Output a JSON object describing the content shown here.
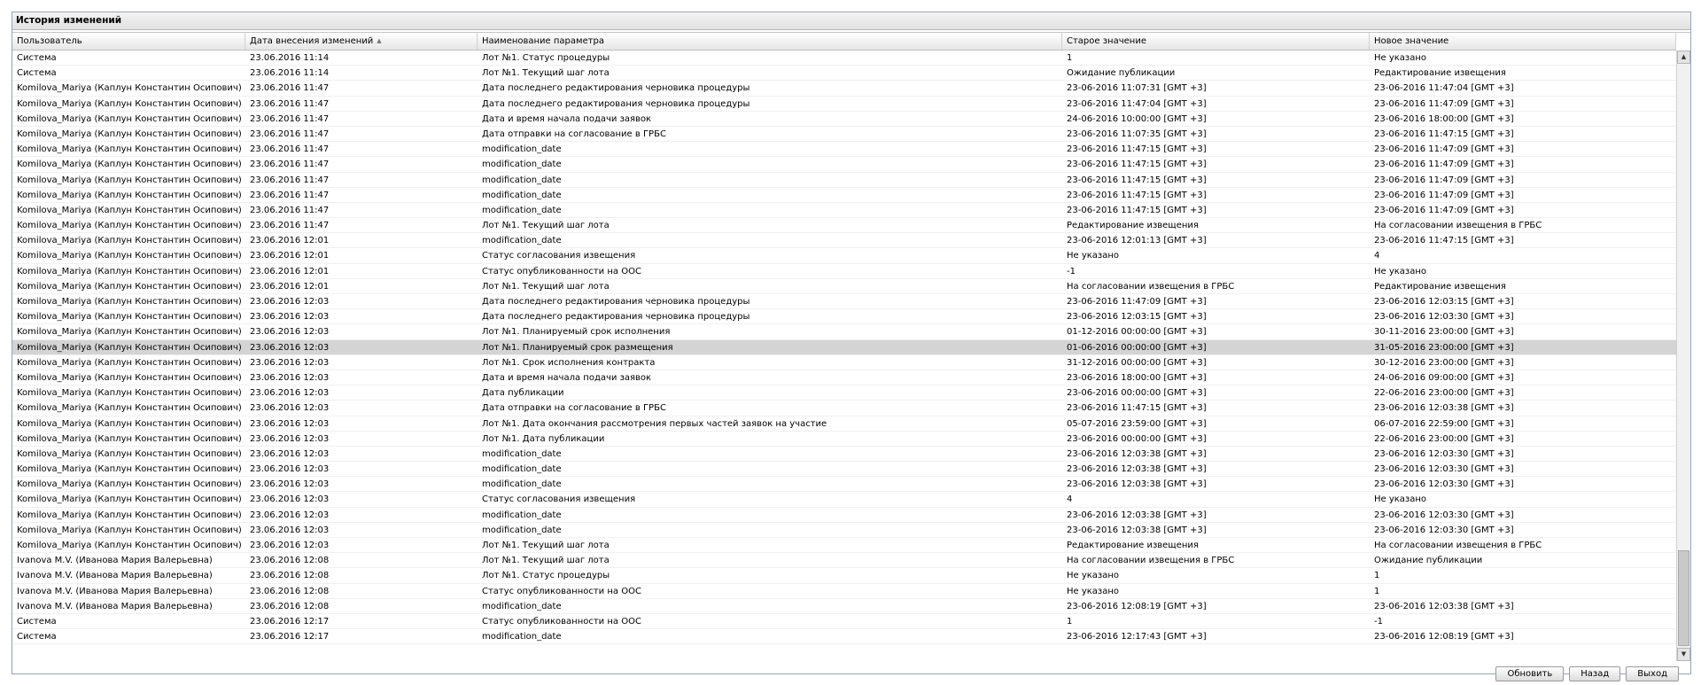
{
  "panel": {
    "title": "История изменений"
  },
  "columns": [
    "Пользователь",
    "Дата внесения изменений",
    "Наименование параметра",
    "Старое значение",
    "Новое значение"
  ],
  "selected_row": 19,
  "rows": [
    [
      "Система",
      "23.06.2016 11:14",
      "Лот №1. Статус процедуры",
      "1",
      "Не указано"
    ],
    [
      "Система",
      "23.06.2016 11:14",
      "Лот №1. Текущий шаг лота",
      "Ожидание публикации",
      "Редактирование извещения"
    ],
    [
      "Komilova_Mariya (Каплун Константин Осипович)",
      "23.06.2016 11:47",
      "Дата последнего редактирования черновика процедуры",
      "23-06-2016 11:07:31 [GMT +3]",
      "23-06-2016 11:47:04 [GMT +3]"
    ],
    [
      "Komilova_Mariya (Каплун Константин Осипович)",
      "23.06.2016 11:47",
      "Дата последнего редактирования черновика процедуры",
      "23-06-2016 11:47:04 [GMT +3]",
      "23-06-2016 11:47:09 [GMT +3]"
    ],
    [
      "Komilova_Mariya (Каплун Константин Осипович)",
      "23.06.2016 11:47",
      "Дата и время начала подачи заявок",
      "24-06-2016 10:00:00 [GMT +3]",
      "23-06-2016 18:00:00 [GMT +3]"
    ],
    [
      "Komilova_Mariya (Каплун Константин Осипович)",
      "23.06.2016 11:47",
      "Дата отправки на согласование в ГРБС",
      "23-06-2016 11:07:35 [GMT +3]",
      "23-06-2016 11:47:15 [GMT +3]"
    ],
    [
      "Komilova_Mariya (Каплун Константин Осипович)",
      "23.06.2016 11:47",
      "modification_date",
      "23-06-2016 11:47:15 [GMT +3]",
      "23-06-2016 11:47:09 [GMT +3]"
    ],
    [
      "Komilova_Mariya (Каплун Константин Осипович)",
      "23.06.2016 11:47",
      "modification_date",
      "23-06-2016 11:47:15 [GMT +3]",
      "23-06-2016 11:47:09 [GMT +3]"
    ],
    [
      "Komilova_Mariya (Каплун Константин Осипович)",
      "23.06.2016 11:47",
      "modification_date",
      "23-06-2016 11:47:15 [GMT +3]",
      "23-06-2016 11:47:09 [GMT +3]"
    ],
    [
      "Komilova_Mariya (Каплун Константин Осипович)",
      "23.06.2016 11:47",
      "modification_date",
      "23-06-2016 11:47:15 [GMT +3]",
      "23-06-2016 11:47:09 [GMT +3]"
    ],
    [
      "Komilova_Mariya (Каплун Константин Осипович)",
      "23.06.2016 11:47",
      "modification_date",
      "23-06-2016 11:47:15 [GMT +3]",
      "23-06-2016 11:47:09 [GMT +3]"
    ],
    [
      "Komilova_Mariya (Каплун Константин Осипович)",
      "23.06.2016 11:47",
      "Лот №1. Текущий шаг лота",
      "Редактирование извещения",
      "На согласовании извещения в ГРБС"
    ],
    [
      "Komilova_Mariya (Каплун Константин Осипович)",
      "23.06.2016 12:01",
      "modification_date",
      "23-06-2016 12:01:13 [GMT +3]",
      "23-06-2016 11:47:15 [GMT +3]"
    ],
    [
      "Komilova_Mariya (Каплун Константин Осипович)",
      "23.06.2016 12:01",
      "Статус согласования извещения",
      "Не указано",
      "4"
    ],
    [
      "Komilova_Mariya (Каплун Константин Осипович)",
      "23.06.2016 12:01",
      "Статус опубликованности на ООС",
      "-1",
      "Не указано"
    ],
    [
      "Komilova_Mariya (Каплун Константин Осипович)",
      "23.06.2016 12:01",
      "Лот №1. Текущий шаг лота",
      "На согласовании извещения в ГРБС",
      "Редактирование извещения"
    ],
    [
      "Komilova_Mariya (Каплун Константин Осипович)",
      "23.06.2016 12:03",
      "Дата последнего редактирования черновика процедуры",
      "23-06-2016 11:47:09 [GMT +3]",
      "23-06-2016 12:03:15 [GMT +3]"
    ],
    [
      "Komilova_Mariya (Каплун Константин Осипович)",
      "23.06.2016 12:03",
      "Дата последнего редактирования черновика процедуры",
      "23-06-2016 12:03:15 [GMT +3]",
      "23-06-2016 12:03:30 [GMT +3]"
    ],
    [
      "Komilova_Mariya (Каплун Константин Осипович)",
      "23.06.2016 12:03",
      "Лот №1. Планируемый срок исполнения",
      "01-12-2016 00:00:00 [GMT +3]",
      "30-11-2016 23:00:00 [GMT +3]"
    ],
    [
      "Komilova_Mariya (Каплун Константин Осипович)",
      "23.06.2016 12:03",
      "Лот №1. Планируемый срок размещения",
      "01-06-2016 00:00:00 [GMT +3]",
      "31-05-2016 23:00:00 [GMT +3]"
    ],
    [
      "Komilova_Mariya (Каплун Константин Осипович)",
      "23.06.2016 12:03",
      "Лот №1. Срок исполнения контракта",
      "31-12-2016 00:00:00 [GMT +3]",
      "30-12-2016 23:00:00 [GMT +3]"
    ],
    [
      "Komilova_Mariya (Каплун Константин Осипович)",
      "23.06.2016 12:03",
      "Дата и время начала подачи заявок",
      "23-06-2016 18:00:00 [GMT +3]",
      "24-06-2016 09:00:00 [GMT +3]"
    ],
    [
      "Komilova_Mariya (Каплун Константин Осипович)",
      "23.06.2016 12:03",
      "Дата публикации",
      "23-06-2016 00:00:00 [GMT +3]",
      "22-06-2016 23:00:00 [GMT +3]"
    ],
    [
      "Komilova_Mariya (Каплун Константин Осипович)",
      "23.06.2016 12:03",
      "Дата отправки на согласование в ГРБС",
      "23-06-2016 11:47:15 [GMT +3]",
      "23-06-2016 12:03:38 [GMT +3]"
    ],
    [
      "Komilova_Mariya (Каплун Константин Осипович)",
      "23.06.2016 12:03",
      "Лот №1. Дата окончания рассмотрения первых частей заявок на участие",
      "05-07-2016 23:59:00 [GMT +3]",
      "06-07-2016 22:59:00 [GMT +3]"
    ],
    [
      "Komilova_Mariya (Каплун Константин Осипович)",
      "23.06.2016 12:03",
      "Лот №1. Дата публикации",
      "23-06-2016 00:00:00 [GMT +3]",
      "22-06-2016 23:00:00 [GMT +3]"
    ],
    [
      "Komilova_Mariya (Каплун Константин Осипович)",
      "23.06.2016 12:03",
      "modification_date",
      "23-06-2016 12:03:38 [GMT +3]",
      "23-06-2016 12:03:30 [GMT +3]"
    ],
    [
      "Komilova_Mariya (Каплун Константин Осипович)",
      "23.06.2016 12:03",
      "modification_date",
      "23-06-2016 12:03:38 [GMT +3]",
      "23-06-2016 12:03:30 [GMT +3]"
    ],
    [
      "Komilova_Mariya (Каплун Константин Осипович)",
      "23.06.2016 12:03",
      "modification_date",
      "23-06-2016 12:03:38 [GMT +3]",
      "23-06-2016 12:03:30 [GMT +3]"
    ],
    [
      "Komilova_Mariya (Каплун Константин Осипович)",
      "23.06.2016 12:03",
      "Статус согласования извещения",
      "4",
      "Не указано"
    ],
    [
      "Komilova_Mariya (Каплун Константин Осипович)",
      "23.06.2016 12:03",
      "modification_date",
      "23-06-2016 12:03:38 [GMT +3]",
      "23-06-2016 12:03:30 [GMT +3]"
    ],
    [
      "Komilova_Mariya (Каплун Константин Осипович)",
      "23.06.2016 12:03",
      "modification_date",
      "23-06-2016 12:03:38 [GMT +3]",
      "23-06-2016 12:03:30 [GMT +3]"
    ],
    [
      "Komilova_Mariya (Каплун Константин Осипович)",
      "23.06.2016 12:03",
      "Лот №1. Текущий шаг лота",
      "Редактирование извещения",
      "На согласовании извещения в ГРБС"
    ],
    [
      "Ivanova M.V. (Иванова Мария Валерьевна)",
      "23.06.2016 12:08",
      "Лот №1. Текущий шаг лота",
      "На согласовании извещения в ГРБС",
      "Ожидание публикации"
    ],
    [
      "Ivanova M.V. (Иванова Мария Валерьевна)",
      "23.06.2016 12:08",
      "Лот №1. Статус процедуры",
      "Не указано",
      "1"
    ],
    [
      "Ivanova M.V. (Иванова Мария Валерьевна)",
      "23.06.2016 12:08",
      "Статус опубликованности на ООС",
      "Не указано",
      "1"
    ],
    [
      "Ivanova M.V. (Иванова Мария Валерьевна)",
      "23.06.2016 12:08",
      "modification_date",
      "23-06-2016 12:08:19 [GMT +3]",
      "23-06-2016 12:03:38 [GMT +3]"
    ],
    [
      "Система",
      "23.06.2016 12:17",
      "Статус опубликованности на ООС",
      "1",
      "-1"
    ],
    [
      "Система",
      "23.06.2016 12:17",
      "modification_date",
      "23-06-2016 12:17:43 [GMT +3]",
      "23-06-2016 12:08:19 [GMT +3]"
    ]
  ],
  "scrollbar": {
    "up_icon": "▲",
    "down_icon": "▼"
  },
  "sort_icon": "▲",
  "buttons": {
    "refresh": "Обновить",
    "back": "Назад",
    "exit": "Выход"
  }
}
